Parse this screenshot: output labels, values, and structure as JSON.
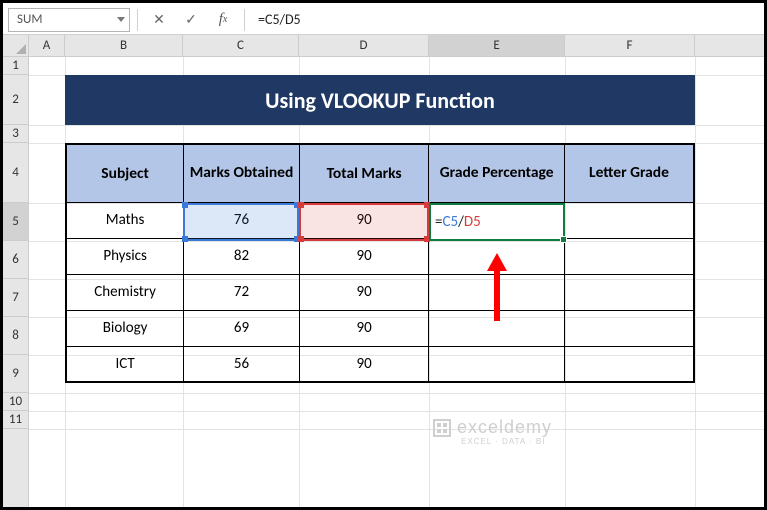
{
  "namebox": {
    "value": "SUM"
  },
  "formula_bar": {
    "formula": "=C5/D5"
  },
  "columns": [
    "A",
    "B",
    "C",
    "D",
    "E",
    "F"
  ],
  "rows": [
    "1",
    "2",
    "3",
    "4",
    "5",
    "6",
    "7",
    "8",
    "9",
    "10",
    "11"
  ],
  "active_column": "E",
  "active_row": "5",
  "title": "Using VLOOKUP Function",
  "headers": {
    "subject": "Subject",
    "marks_obtained": "Marks Obtained",
    "total_marks": "Total Marks",
    "grade_percentage": "Grade Percentage",
    "letter_grade": "Letter Grade"
  },
  "data_rows": [
    {
      "subject": "Maths",
      "marks": "76",
      "total": "90"
    },
    {
      "subject": "Physics",
      "marks": "82",
      "total": "90"
    },
    {
      "subject": "Chemistry",
      "marks": "72",
      "total": "90"
    },
    {
      "subject": "Biology",
      "marks": "69",
      "total": "90"
    },
    {
      "subject": "ICT",
      "marks": "56",
      "total": "90"
    }
  ],
  "edit_cell": {
    "eq": "=",
    "ref1": "C5",
    "slash": "/",
    "ref2": "D5"
  },
  "watermark": {
    "name": "exceldemy",
    "tagline": "EXCEL · DATA · BI"
  }
}
